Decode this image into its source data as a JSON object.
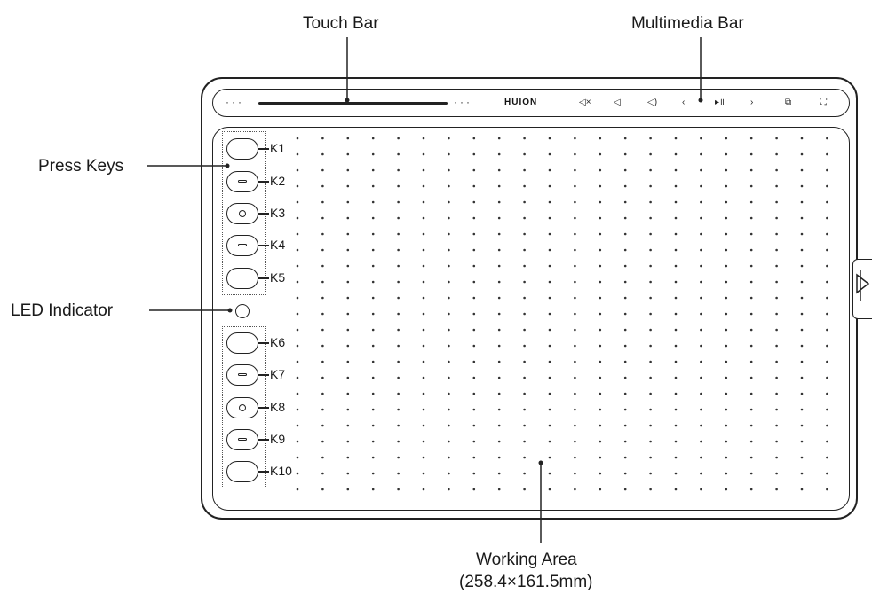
{
  "labels": {
    "touch_bar": "Touch Bar",
    "multimedia_bar": "Multimedia Bar",
    "press_keys": "Press Keys",
    "led_indicator": "LED Indicator",
    "working_area": "Working Area",
    "working_area_size": "(258.4×161.5mm)"
  },
  "brand": "HUION",
  "keys": [
    "K1",
    "K2",
    "K3",
    "K4",
    "K5",
    "K6",
    "K7",
    "K8",
    "K9",
    "K10"
  ],
  "multimedia_icons": [
    "mute-icon",
    "volume-down-icon",
    "volume-up-icon",
    "previous-icon",
    "play-pause-icon",
    "next-icon",
    "screen-switch-icon",
    "fullscreen-icon"
  ],
  "multimedia_glyphs": [
    "◁×",
    "◁",
    "◁)",
    "‹",
    "▸॥",
    "›",
    "⧉",
    "⛶"
  ],
  "colors": {
    "line": "#222222",
    "background": "#ffffff"
  }
}
